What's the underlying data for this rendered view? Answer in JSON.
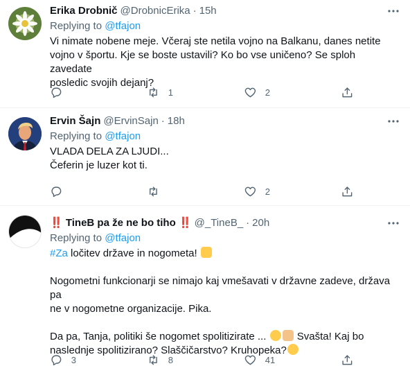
{
  "tweets": [
    {
      "name": "Erika Drobnič",
      "handle": "@DrobnicErika",
      "dot": "·",
      "time": "15h",
      "replying_prefix": "Replying to",
      "replying_to": "@tfajon",
      "lines": [
        "Vi nimate nobene meje. Včeraj ste netila vojno na Balkanu, danes netite",
        "vojno v športu. Kje se boste ustavili? Ko bo vse uničeno? Se sploh zavedate",
        "posledic  svojih dejanj?"
      ],
      "reply_count": "",
      "retweet_count": "1",
      "like_count": "2"
    },
    {
      "name": "Ervin Šajn",
      "handle": "@ErvinSajn",
      "dot": "·",
      "time": "18h",
      "replying_prefix": "Replying to",
      "replying_to": "@tfajon",
      "lines": [
        "VLADA DELA ZA LJUDI...",
        "Čeferin je luzer kot ti."
      ],
      "reply_count": "",
      "retweet_count": "",
      "like_count": "2"
    },
    {
      "name_prefix": "‼️",
      "name": "TineB pa že ne bo tiho",
      "name_suffix": "‼️",
      "handle": "@_TineB_",
      "dot": "·",
      "time": "20h",
      "replying_prefix": "Replying to",
      "replying_to": "@tfajon",
      "hashtag": "#Za",
      "line1_rest": " ločitev države in nogometa!",
      "para2_line1": "Nogometni funkcionarji se nimajo kaj vmešavati v državne zadeve, država pa",
      "para2_line2": "ne v nogometne organizacije. Pika.",
      "para3_line1_a": "Da pa, Tanja, politiki še nogomet spolitizirate ... ",
      "para3_line1_b": " Svašta! Kaj bo",
      "para3_line2_a": "naslednje spolitizirano? Slaščičarstvo?  Kruhopeka?",
      "reply_count": "3",
      "retweet_count": "8",
      "like_count": "41"
    }
  ],
  "icons": {
    "more": "more-horizontal-icon",
    "reply": "reply-bubble-icon",
    "retweet": "retweet-icon",
    "like": "heart-icon",
    "share": "share-icon"
  },
  "colors": {
    "link": "#1d9bf0",
    "secondary": "#536471",
    "text": "#0f1419",
    "divider": "#eff3f4"
  }
}
